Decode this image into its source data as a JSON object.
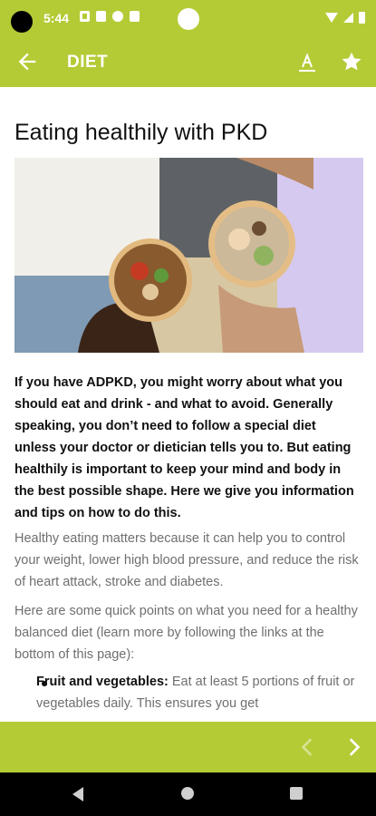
{
  "status_bar": {
    "time": "5:44"
  },
  "app_bar": {
    "title": "DIET",
    "icons": {
      "back": "arrow-left-icon",
      "font": "text-size-icon",
      "favorite": "star-icon"
    }
  },
  "article": {
    "title": "Eating healthily with PKD",
    "image_description_icon": "food-bowls-photo",
    "intro": "If you have ADPKD, you might worry about what you should eat and drink - and what to avoid. Generally speaking, you don’t need to follow a special diet unless your doctor or dietician tells you to. But eating healthily is important to keep your mind and body in the best possible shape. Here we give you information and tips on how to do this.",
    "paragraph_1": "Healthy eating matters because it can help you to control your weight, lower high blood pressure, and reduce the risk of heart attack, stroke and diabetes.",
    "paragraph_2": "Here are some quick points on what you need for a healthy balanced diet (learn more by following the links at the bottom of this page):",
    "bullets": [
      {
        "label": "Fruit and vegetables:",
        "text": " Eat at least 5 portions of fruit or vegetables daily. This ensures you get"
      }
    ]
  },
  "footer": {
    "prev_icon": "chevron-left-icon",
    "next_icon": "chevron-right-icon"
  },
  "colors": {
    "brand": "#b5cb36",
    "text": "#111111",
    "muted_text": "#6f6f6f"
  }
}
